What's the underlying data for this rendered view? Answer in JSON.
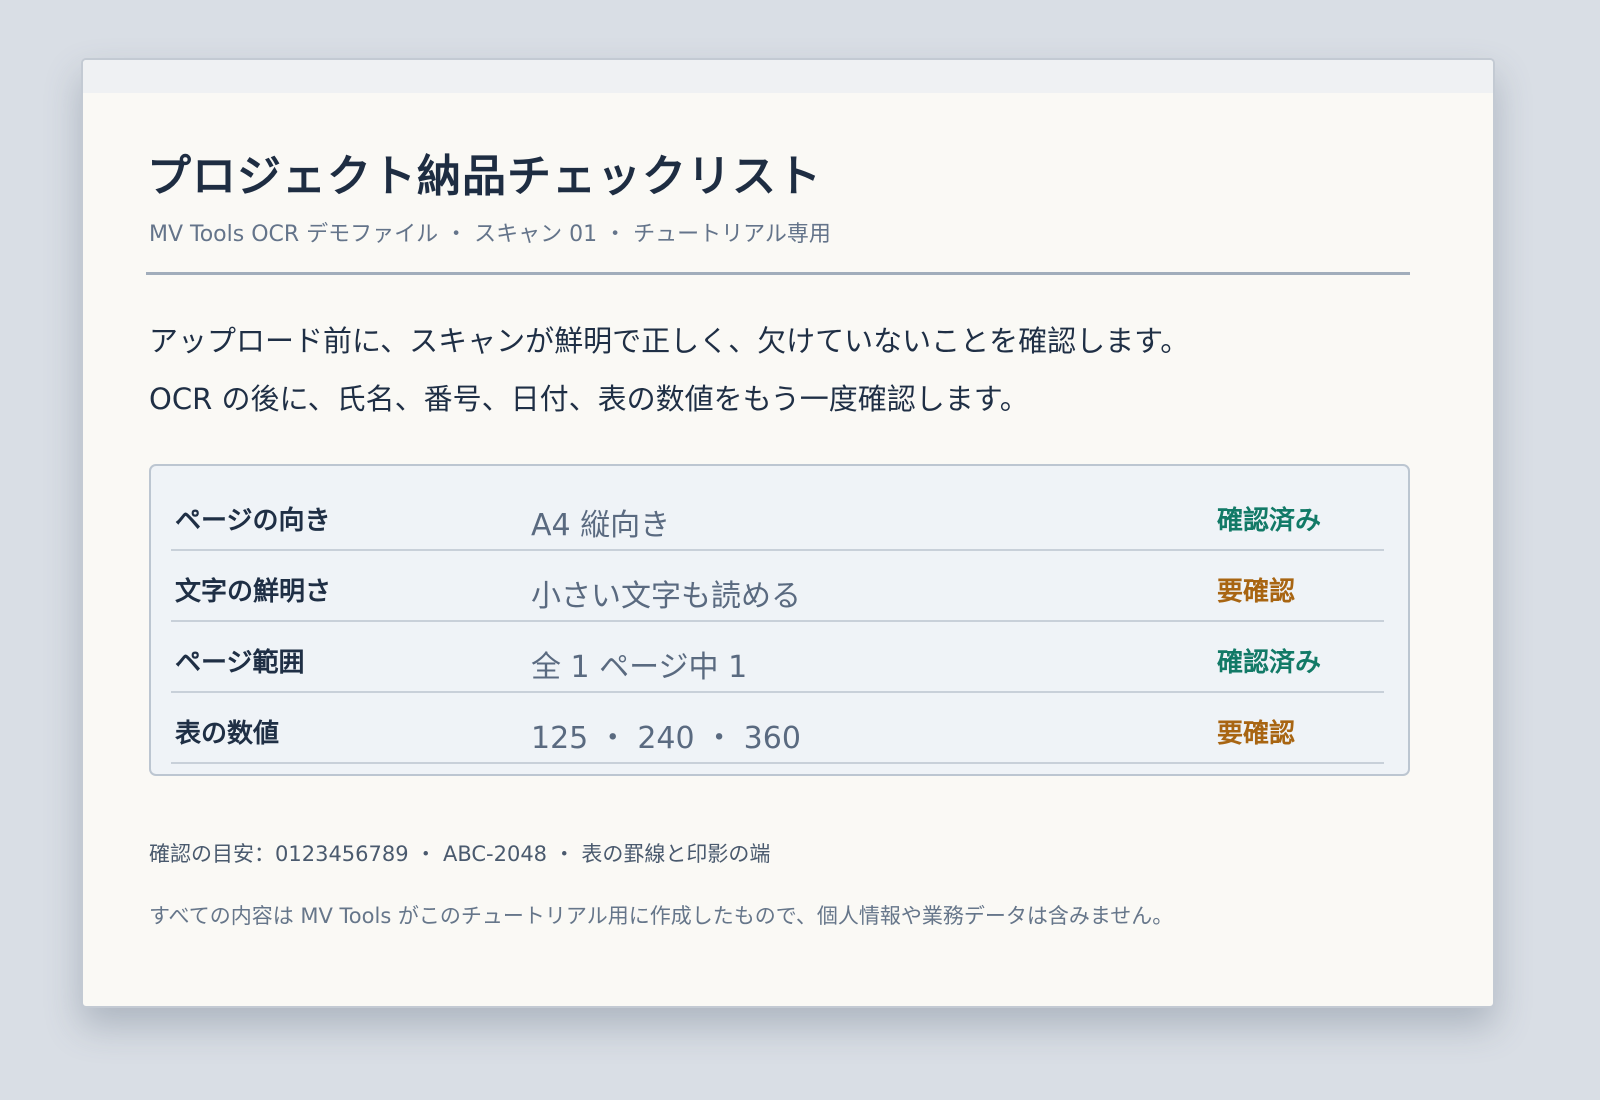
{
  "document": {
    "title": "プロジェクト納品チェックリスト",
    "subtitle": "MV Tools OCR デモファイル ・ スキャン 01 ・ チュートリアル専用",
    "body_lines": [
      "アップロード前に、スキャンが鮮明で正しく、欠けていないことを確認します。",
      "OCR の後に、氏名、番号、日付、表の数値をもう一度確認します。"
    ],
    "checklist": [
      {
        "label": "ページの向き",
        "value": "A4 縦向き",
        "status": "確認済み"
      },
      {
        "label": "文字の鮮明さ",
        "value": "小さい文字も読める",
        "status": "要確認"
      },
      {
        "label": "ページ範囲",
        "value": "全 1 ページ中 1",
        "status": "確認済み"
      },
      {
        "label": "表の数値",
        "value": "125 ・ 240 ・ 360",
        "status": "要確認"
      }
    ],
    "footnote_reference": "確認の目安：0123456789 ・ ABC-2048 ・ 表の罫線と印影の端",
    "footnote_disclaimer": "すべての内容は MV Tools がこのチュートリアル用に作成したもので、個人情報や業務データは含みません。"
  },
  "colors": {
    "page_background": "#d9dee5",
    "card_background": "#faf9f5",
    "title_text": "#1e2d42",
    "status_verified": "#127a67",
    "status_needs_check": "#a86512"
  }
}
